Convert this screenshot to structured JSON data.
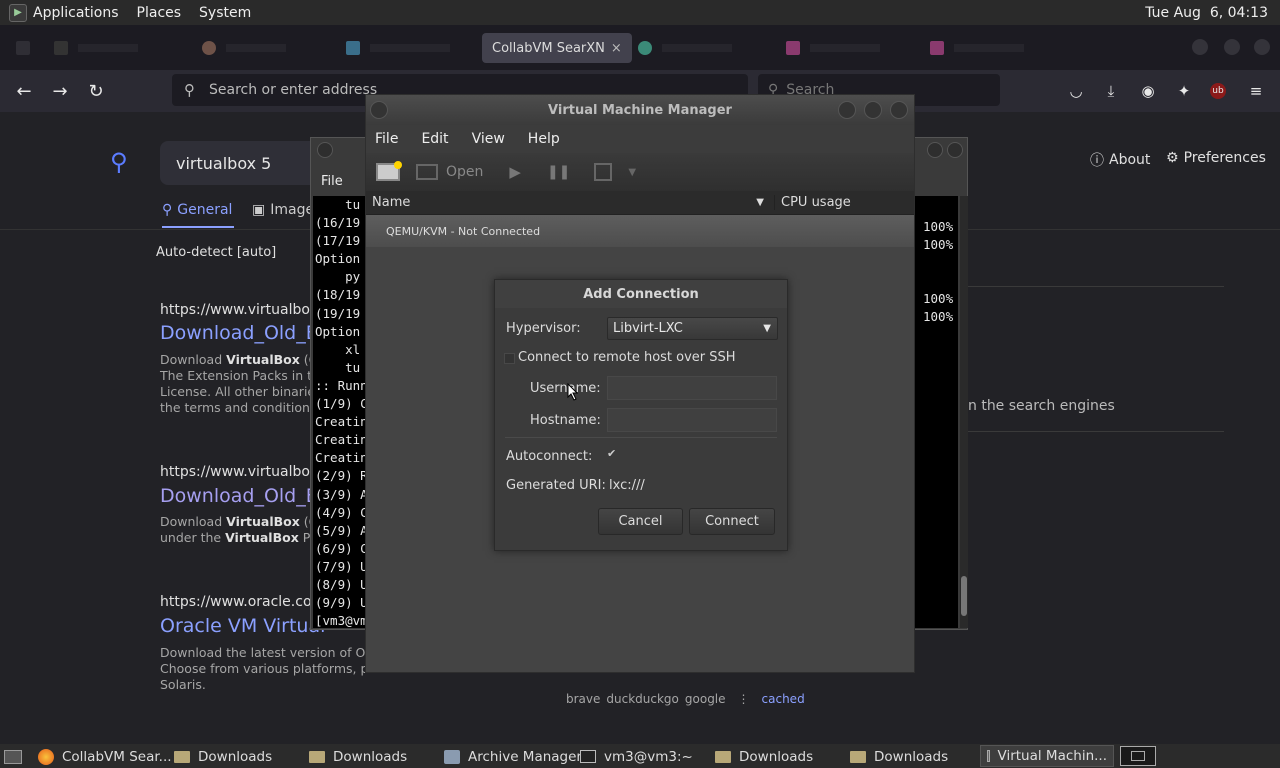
{
  "top_panel": {
    "menus": [
      "Applications",
      "Places",
      "System"
    ],
    "clock": "Tue Aug  6, 04:13"
  },
  "browser": {
    "tabs": [
      {
        "label": "CollabVM SearXN",
        "active": true,
        "close": "×"
      }
    ],
    "address_placeholder": "Search or enter address",
    "search_placeholder": "Search"
  },
  "page": {
    "query": "virtualbox 5",
    "tabs": [
      "General",
      "Images"
    ],
    "language": "Auto-detect [auto]",
    "about": "About",
    "preferences": "Preferences",
    "engines_text": "n the search engines",
    "results": [
      {
        "url": "https://www.virtualbox.o",
        "title": "Download_Old_B",
        "desc": [
          "Download VirtualBox (Ol",
          "The Extension Packs in th",
          "License. All other binaries",
          "the terms and conditions o"
        ]
      },
      {
        "url": "https://www.virtualbox.o",
        "title": "Download_Old_B",
        "desc": [
          "Download VirtualBox (Ol",
          "under the VirtualBox Pers"
        ]
      },
      {
        "url": "https://www.oracle.com",
        "title": "Oracle VM Virtual",
        "desc": [
          "Download the latest version of Orac",
          "Choose from various platforms, pac",
          "Solaris."
        ]
      }
    ],
    "footer_engines": [
      "brave",
      "duckduckgo",
      "google"
    ],
    "footer_sep": "⋮",
    "footer_cached": "cached"
  },
  "terminal": {
    "menu_file": "File",
    "lines": [
      "    tu",
      "(16/19",
      "(17/19",
      "Option",
      "    py",
      "(18/19",
      "(19/19",
      "Option",
      "    xl",
      "    tu",
      ":: Runn",
      "(1/9) C",
      "Creatin",
      "Creatin",
      "Creatin",
      "(2/9) R",
      "(3/9) A",
      "(4/9) C",
      "(5/9) A",
      "(6/9) C",
      "(7/9) U",
      "(8/9) U",
      "(9/9) U",
      "[vm3@vm"
    ],
    "percent_lines": [
      "100%",
      "100%",
      "100%",
      "100%"
    ]
  },
  "vmm": {
    "title": "Virtual Machine Manager",
    "menu": [
      "File",
      "Edit",
      "View",
      "Help"
    ],
    "toolbar_open": "Open",
    "col_name": "Name",
    "col_cpu": "CPU usage",
    "row": "QEMU/KVM - Not Connected"
  },
  "dialog": {
    "title": "Add Connection",
    "hypervisor_label": "Hypervisor:",
    "hypervisor_value": "Libvirt-LXC",
    "ssh_label": "Connect to remote host over SSH",
    "username_label": "Username:",
    "hostname_label": "Hostname:",
    "autoconnect_label": "Autoconnect:",
    "autoconnect_checked": true,
    "uri_label": "Generated URI:",
    "uri_value": "lxc:///",
    "cancel": "Cancel",
    "connect": "Connect"
  },
  "taskbar": {
    "items": [
      "CollabVM Sear...",
      "Downloads",
      "Downloads",
      "Archive Manager",
      "vm3@vm3:~",
      "Downloads",
      "Downloads",
      "Virtual Machin..."
    ]
  }
}
